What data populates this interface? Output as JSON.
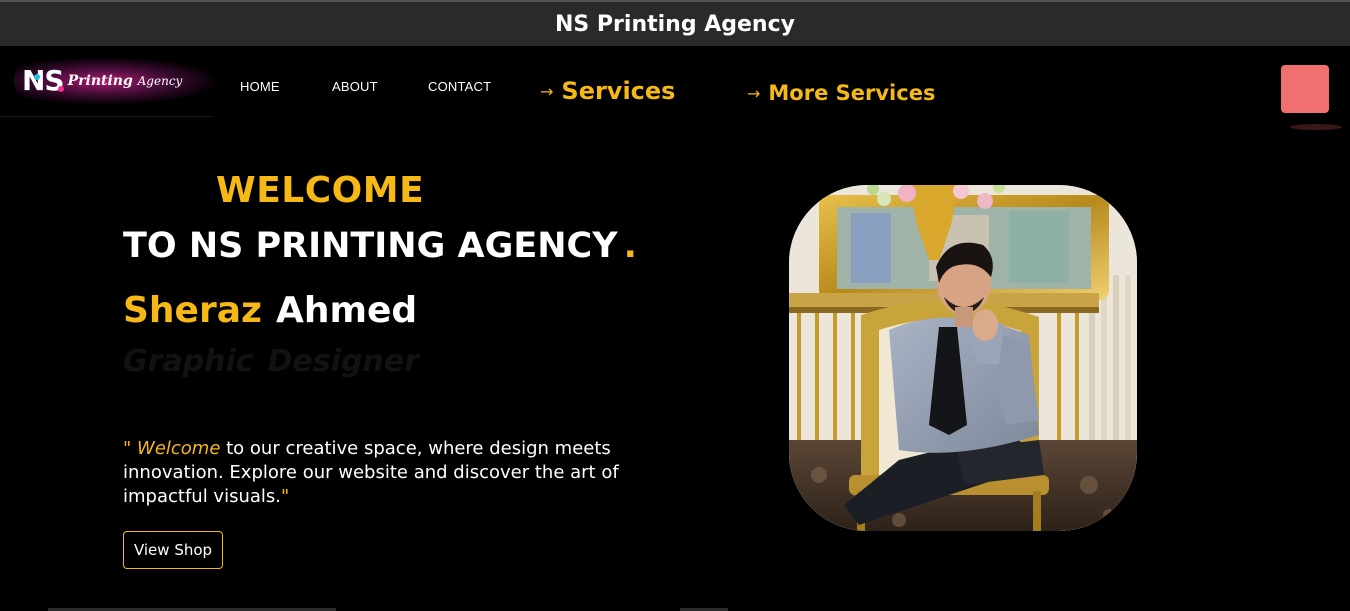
{
  "window": {
    "title": "NS Printing Agency"
  },
  "logo": {
    "mark": "NS",
    "word": "Printing",
    "sub": "Agency"
  },
  "nav": {
    "links": [
      {
        "label": "HOME"
      },
      {
        "label": "ABOUT"
      },
      {
        "label": "CONTACT"
      }
    ],
    "services_arrow": "→",
    "services_label": "Services",
    "more_arrow": "→",
    "more_label": "More Services"
  },
  "hero": {
    "welcome": "WELCOME",
    "to_agency": "TO NS PRINTING AGENCY",
    "dot": ".",
    "first_name": "Sheraz",
    "last_name": "Ahmed",
    "role_1": "Graphic",
    "role_2": "Designer",
    "intro_quote_open": "\"",
    "intro_highlight": "Welcome",
    "intro_text": " to our creative space, where design meets innovation. Explore our website and discover the art of impactful visuals.",
    "intro_quote_close": "\"",
    "cta_label": "View Shop"
  },
  "colors": {
    "accent": "#f5b815",
    "menu_toggle": "#f07070",
    "background": "#000000",
    "title_bar": "#2a2a2a"
  }
}
